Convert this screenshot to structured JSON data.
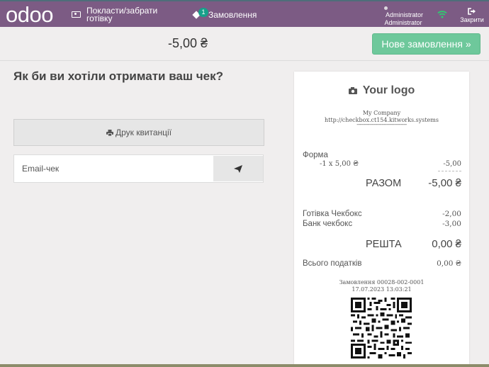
{
  "header": {
    "logo_text": "odoo",
    "cash_in_out_label": "Покласти/забрати готівку",
    "orders_label": "Замовлення",
    "orders_badge": "1",
    "user_name_top": "Administrator",
    "user_name_bottom": "Administrator",
    "close_label": "Закрити",
    "bar_color": "#7c5b84",
    "status_color": "#2ecc71"
  },
  "subbar": {
    "total": "-5,00 ₴",
    "new_order_label": "Нове замовлення »"
  },
  "receipt_screen": {
    "question": "Як би ви хотіли отримати ваш чек?",
    "print_label": "Друк квитанції",
    "email_placeholder": "Email-чек"
  },
  "receipt": {
    "logo_text": "Your logo",
    "company_name": "My Company",
    "company_url": "http://checkbox.ct154.kitworks.systems",
    "separator": "--------------------------------",
    "line_item": {
      "name": "Форма",
      "qty_line": "-1 x 5,00 ₴",
      "amount": "-5,00"
    },
    "total_label": "РАЗОМ",
    "total_value": "-5,00 ₴",
    "payments": [
      {
        "name": "Готівка Чекбокс",
        "amount": "-2,00"
      },
      {
        "name": "Банк чекбокс",
        "amount": "-3,00"
      }
    ],
    "change_label": "РЕШТА",
    "change_value": "0,00 ₴",
    "taxes_label": "Всього податків",
    "taxes_value": "0,00 ₴",
    "order_ref": "Замовлення 00028-002-0001",
    "order_datetime": "17.07.2023 13:03:21"
  },
  "icons": {
    "cash": "money-icon",
    "orders": "ticket-icon",
    "user": "user-avatar-icon",
    "wifi": "wifi-icon",
    "close": "sign-out-icon",
    "print": "printer-icon",
    "send": "paper-plane-icon",
    "camera": "camera-icon",
    "qr": "qr-code"
  }
}
